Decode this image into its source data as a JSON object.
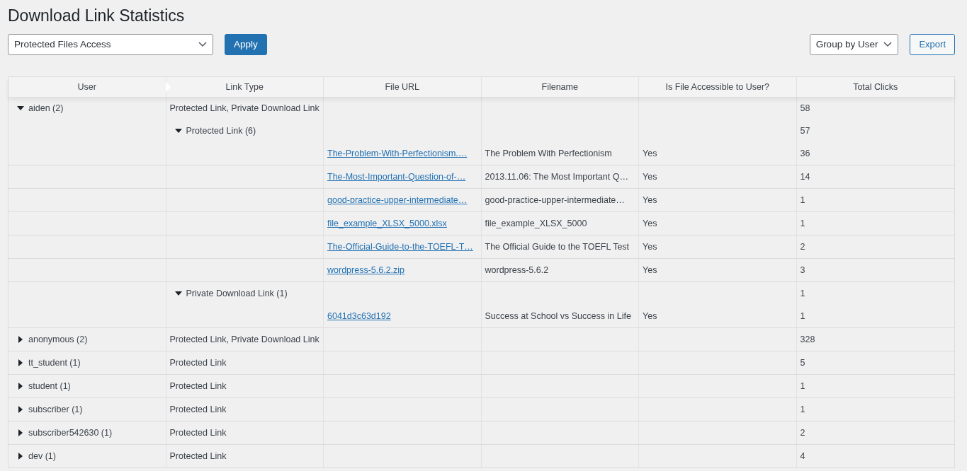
{
  "title": "Download Link Statistics",
  "report_select": {
    "value": "Protected Files Access"
  },
  "apply_button": "Apply",
  "group_select": {
    "value": "Group by User"
  },
  "export_button": "Export",
  "table": {
    "columns": [
      "User",
      "Link Type",
      "File URL",
      "Filename",
      "Is File Accessible to User?",
      "Total Clicks"
    ],
    "users": [
      {
        "name": "aiden (2)",
        "link_type": "Protected Link, Private Download Link",
        "total": "58",
        "expanded": true,
        "children": [
          {
            "label": "Protected Link (6)",
            "total": "57",
            "expanded": true,
            "children": [
              {
                "url": "The-Problem-With-Perfectionism.…",
                "filename": "The Problem With Perfectionism",
                "accessible": "Yes",
                "total": "36"
              },
              {
                "url": "The-Most-Important-Question-of-…",
                "filename": "2013.11.06: The Most Important Q…",
                "accessible": "Yes",
                "total": "14"
              },
              {
                "url": "good-practice-upper-intermediate…",
                "filename": "good-practice-upper-intermediate…",
                "accessible": "Yes",
                "total": "1"
              },
              {
                "url": "file_example_XLSX_5000.xlsx",
                "filename": "file_example_XLSX_5000",
                "accessible": "Yes",
                "total": "1"
              },
              {
                "url": "The-Official-Guide-to-the-TOEFL-T…",
                "filename": "The Official Guide to the TOEFL Test",
                "accessible": "Yes",
                "total": "2"
              },
              {
                "url": "wordpress-5.6.2.zip",
                "filename": "wordpress-5.6.2",
                "accessible": "Yes",
                "total": "3"
              }
            ]
          },
          {
            "label": "Private Download Link (1)",
            "total": "1",
            "expanded": true,
            "children": [
              {
                "url": "6041d3c63d192",
                "filename": "Success at School vs Success in Life",
                "accessible": "Yes",
                "total": "1"
              }
            ]
          }
        ]
      },
      {
        "name": "anonymous (2)",
        "link_type": "Protected Link, Private Download Link",
        "total": "328",
        "expanded": false
      },
      {
        "name": "tt_student (1)",
        "link_type": "Protected Link",
        "total": "5",
        "expanded": false
      },
      {
        "name": "student (1)",
        "link_type": "Protected Link",
        "total": "1",
        "expanded": false
      },
      {
        "name": "subscriber (1)",
        "link_type": "Protected Link",
        "total": "1",
        "expanded": false
      },
      {
        "name": "subscriber542630 (1)",
        "link_type": "Protected Link",
        "total": "2",
        "expanded": false
      },
      {
        "name": "dev (1)",
        "link_type": "Protected Link",
        "total": "4",
        "expanded": false
      }
    ]
  }
}
